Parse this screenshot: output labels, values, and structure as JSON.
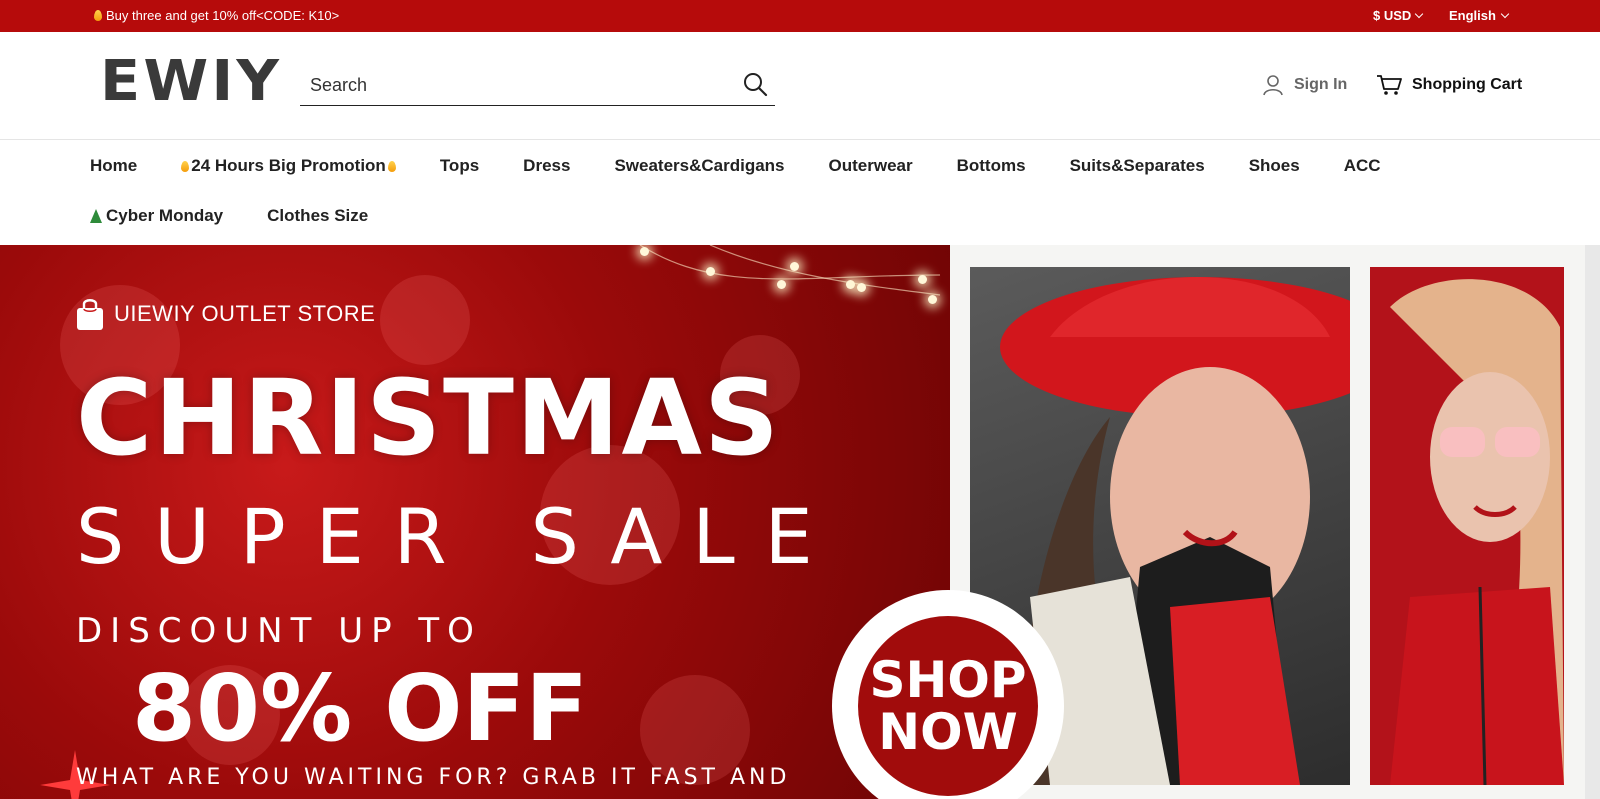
{
  "topbar": {
    "promo_text": "Buy three and get 10% off<CODE: K10>",
    "currency": "$ USD",
    "language": "English"
  },
  "header": {
    "logo_text": "EWIY",
    "search_placeholder": "Search",
    "sign_in": "Sign In",
    "cart": "Shopping Cart"
  },
  "nav": {
    "items": [
      {
        "label": "Home"
      },
      {
        "label": "24 Hours Big Promotion"
      },
      {
        "label": "Tops"
      },
      {
        "label": "Dress"
      },
      {
        "label": "Sweaters&Cardigans"
      },
      {
        "label": "Outerwear"
      },
      {
        "label": "Bottoms"
      },
      {
        "label": "Suits&Separates"
      },
      {
        "label": "Shoes"
      },
      {
        "label": "ACC"
      },
      {
        "label": "Cyber Monday"
      },
      {
        "label": "Clothes Size"
      }
    ]
  },
  "hero": {
    "store_label": "UIEWIY OUTLET STORE",
    "title": "CHRISTMAS",
    "subtitle": "SUPER SALE",
    "discount_line": "DISCOUNT UP TO",
    "discount_value": "80% OFF",
    "bottom_line": "WHAT ARE YOU WAITING FOR? GRAB IT FAST AND",
    "cta_line1": "SHOP",
    "cta_line2": "NOW"
  },
  "colors": {
    "brand_red": "#b60b0b",
    "hero_red": "#9b0a0a"
  },
  "icons": {
    "search": "search-icon",
    "user": "user-icon",
    "cart": "cart-icon",
    "bag": "shopping-bag-icon"
  }
}
